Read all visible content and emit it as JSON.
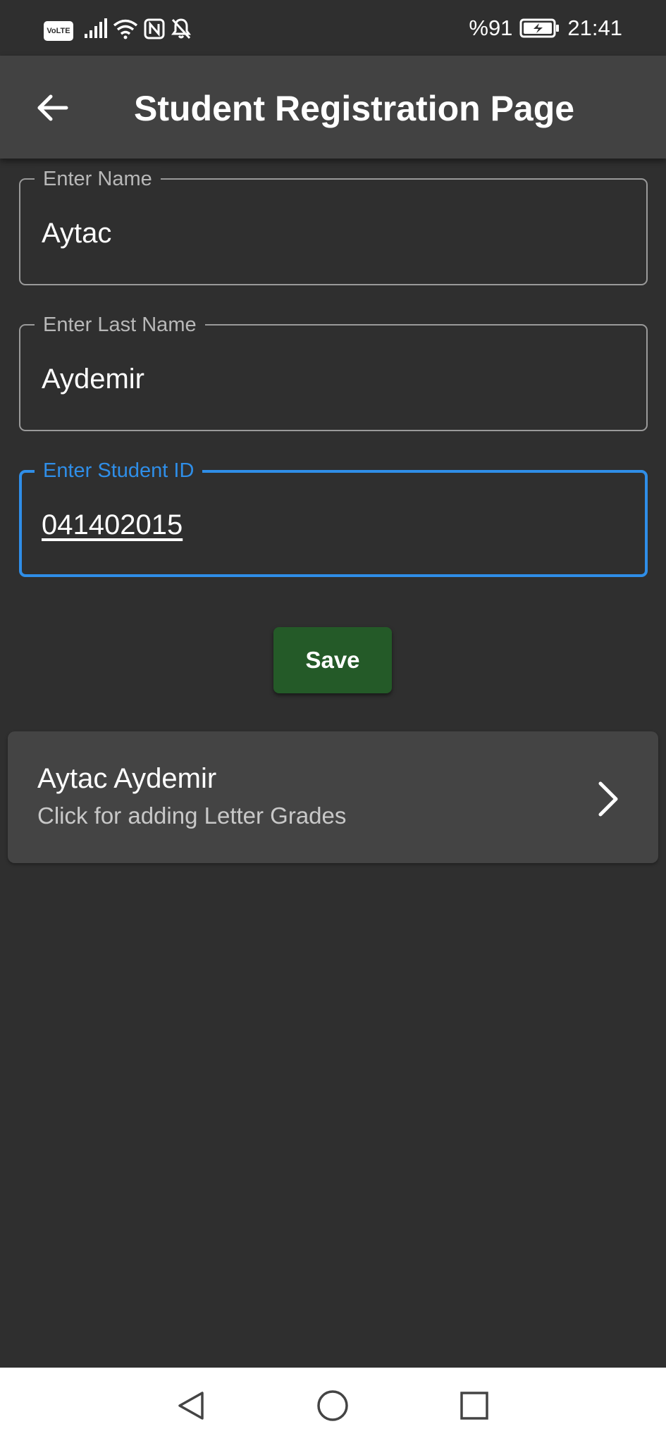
{
  "status_bar": {
    "volte": "VoLTE",
    "battery_percent": "%91",
    "time": "21:41",
    "icons": [
      "volte-icon",
      "signal-icon",
      "wifi-icon",
      "nfc-icon",
      "bell-off-icon",
      "battery-charging-icon"
    ],
    "battery_level": 0.91
  },
  "app_bar": {
    "back_icon": "arrow-left-icon",
    "title": "Student Registration Page"
  },
  "form": {
    "name_label": "Enter Name",
    "name_value": "Aytac",
    "last_name_label": "Enter Last Name",
    "last_name_value": "Aydemir",
    "student_id_label": "Enter Student ID",
    "student_id_value": "041402015",
    "save_label": "Save"
  },
  "students": [
    {
      "name": "Aytac Aydemir",
      "subtitle": "Click for adding Letter Grades",
      "icon": "chevron-right-icon"
    }
  ],
  "nav_bar": {
    "icons": [
      "back-triangle-icon",
      "home-circle-icon",
      "recents-square-icon"
    ]
  },
  "colors": {
    "background": "#2f2f2f",
    "app_bar": "#424242",
    "accent_focus": "#2f8ee8",
    "save_button": "#245a28",
    "card": "#444444"
  }
}
